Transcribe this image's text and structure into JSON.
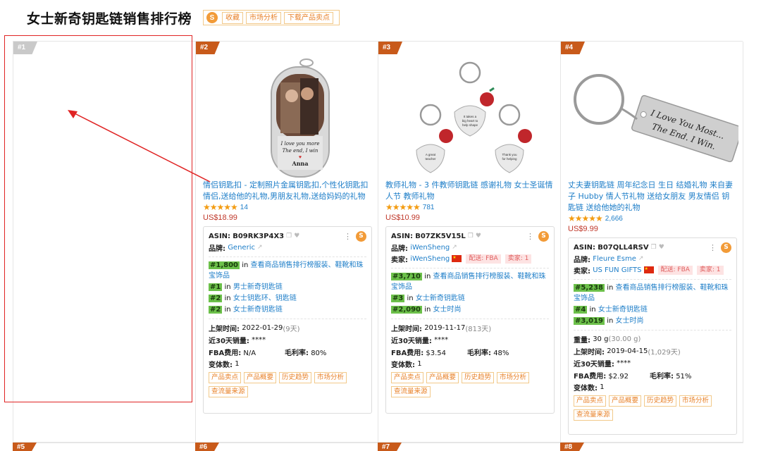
{
  "header": {
    "title": "女士新奇钥匙链销售排行榜",
    "logo": "S",
    "buttons": [
      "收藏",
      "市场分析",
      "下载产品卖点"
    ]
  },
  "colors": {
    "accent": "#f29b38",
    "link": "#1e7ec8",
    "price": "#c0392b",
    "rank_badge": "#6cc04a",
    "highlight": "#e02424"
  },
  "labels": {
    "asin": "ASIN:",
    "brand": "品牌:",
    "seller": "卖家:",
    "in": "in",
    "weight": "重量:",
    "listed": "上架时间:",
    "sales30": "近30天销量:",
    "fba_fee": "FBA费用:",
    "margin": "毛利率:",
    "variants": "变体数:"
  },
  "card1": {
    "rank": "#1"
  },
  "products": [
    {
      "rank": "#2",
      "title": "情侣钥匙扣 - 定制照片金属钥匙扣,个性化钥匙扣情侣,送给他的礼物,男朋友礼物,送给妈妈的礼物",
      "rating_count": "14",
      "price": "US$18.99",
      "asin": "B09RK3P4X3",
      "brand": "Generic",
      "ranks": [
        {
          "rank": "#1,800",
          "cat": "查看商品销售排行榜服装、鞋靴和珠宝饰品"
        },
        {
          "rank": "#1",
          "cat": "男士新奇钥匙链"
        },
        {
          "rank": "#2",
          "cat": "女士钥匙环、钥匙链"
        },
        {
          "rank": "#2",
          "cat": "女士新奇钥匙链"
        }
      ],
      "listed": "2022-01-29",
      "listed_days": "(9天)",
      "sales30": "****",
      "fba_fee": "N/A",
      "margin": "80%",
      "variants": "1",
      "actions": [
        "产品卖点",
        "产品概要",
        "历史趋势",
        "市场分析",
        "查流量来源"
      ]
    },
    {
      "rank": "#3",
      "title": "教师礼物 - 3 件教师钥匙链 感谢礼物 女士圣诞情人节 教师礼物",
      "rating_count": "781",
      "price": "US$10.99",
      "asin": "B07ZK5V15L",
      "brand": "iWenSheng",
      "seller": "iWenSheng",
      "ship": "配送: FBA",
      "seller_count": "卖家: 1",
      "ranks": [
        {
          "rank": "#3,710",
          "cat": "查看商品销售排行榜服装、鞋靴和珠宝饰品"
        },
        {
          "rank": "#3",
          "cat": "女士新奇钥匙链"
        },
        {
          "rank": "#2,090",
          "cat": "女士时尚"
        }
      ],
      "listed": "2019-11-17",
      "listed_days": "(813天)",
      "sales30": "****",
      "fba_fee": "$3.54",
      "margin": "48%",
      "variants": "1",
      "actions": [
        "产品卖点",
        "产品概要",
        "历史趋势",
        "市场分析",
        "查流量来源"
      ]
    },
    {
      "rank": "#4",
      "title": "丈夫妻钥匙链 周年纪念日 生日 结婚礼物 来自妻子 Hubby 情人节礼物 送给女朋友 男友情侣 钥匙链 送给他她的礼物",
      "rating_count": "2,666",
      "price": "US$9.99",
      "asin": "B07QLL4RSV",
      "brand": "Fleure Esme",
      "seller": "US FUN GIFTS",
      "ship": "配送: FBA",
      "seller_count": "卖家: 1",
      "ranks": [
        {
          "rank": "#5,238",
          "cat": "查看商品销售排行榜服装、鞋靴和珠宝饰品"
        },
        {
          "rank": "#4",
          "cat": "女士新奇钥匙链"
        },
        {
          "rank": "#3,019",
          "cat": "女士时尚"
        }
      ],
      "weight": "30 g",
      "weight_alt": "(30.00 g)",
      "listed": "2019-04-15",
      "listed_days": "(1,029天)",
      "sales30": "****",
      "fba_fee": "$2.92",
      "margin": "51%",
      "variants": "1",
      "actions": [
        "产品卖点",
        "产品概要",
        "历史趋势",
        "市场分析",
        "查流量来源"
      ]
    }
  ],
  "row2_ranks": [
    "#5",
    "#6",
    "#7",
    "#8"
  ],
  "image_text": {
    "tag": "I love you more\nThe end, I win\nAnna",
    "keychain_text": "I Love You Most... The End. I Win.",
    "charm1": "It takes a big heart to help shape little minds",
    "charm2": "Thank you for helping me grow & learn",
    "charm3": "A great teacher is hard to find"
  }
}
